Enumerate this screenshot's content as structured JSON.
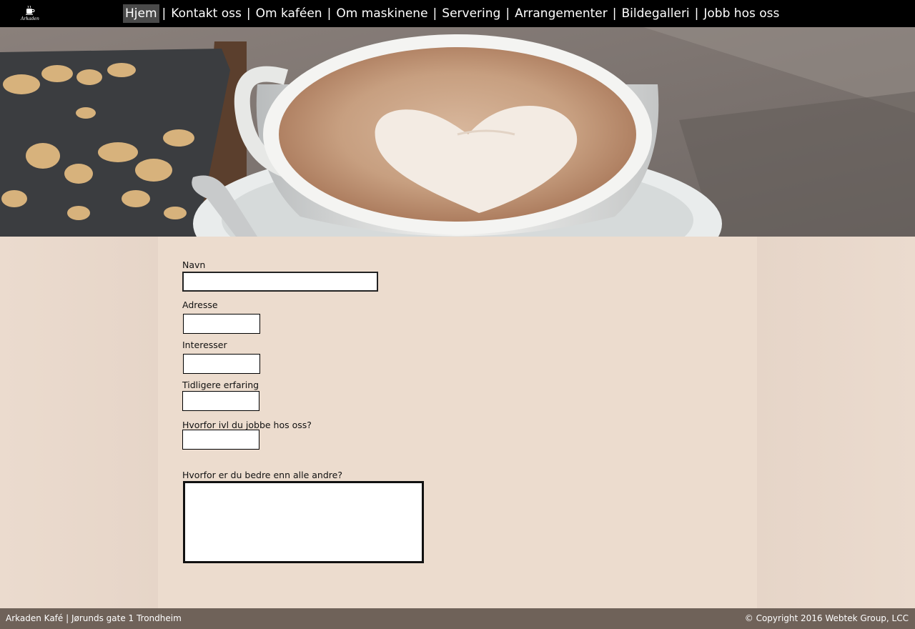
{
  "header": {
    "logo_text": "Arkaden",
    "nav": [
      {
        "label": "Hjem",
        "active": true
      },
      {
        "label": "Kontakt oss"
      },
      {
        "label": "Om kaféen"
      },
      {
        "label": "Om maskinene"
      },
      {
        "label": "Servering"
      },
      {
        "label": "Arrangementer"
      },
      {
        "label": "Bildegalleri"
      },
      {
        "label": "Jobb hos oss"
      }
    ],
    "separator": "|"
  },
  "form": {
    "navn_label": "Navn",
    "navn_value": "",
    "adresse_label": "Adresse",
    "adresse_value": "",
    "interesser_label": "Interesser",
    "interesser_value": "",
    "erfaring_label": "Tidligere  erfaring",
    "erfaring_value": "",
    "hvorfor_label": "Hvorfor ivl du jobbe hos oss?",
    "hvorfor_value": "",
    "bedre_label": "Hvorfor er du bedre enn alle andre?",
    "bedre_value": ""
  },
  "footer": {
    "left": "Arkaden Kafé | Jørunds gate 1 Trondheim",
    "right": "© Copyright 2016 Webtek Group, LCC"
  },
  "colors": {
    "topbar": "#000000",
    "nav_active_bg": "#4a4a4a",
    "content_bg": "#ecdcce",
    "footer_bg": "#6f6259"
  },
  "icons": {
    "logo": "coffee-cup-icon"
  }
}
